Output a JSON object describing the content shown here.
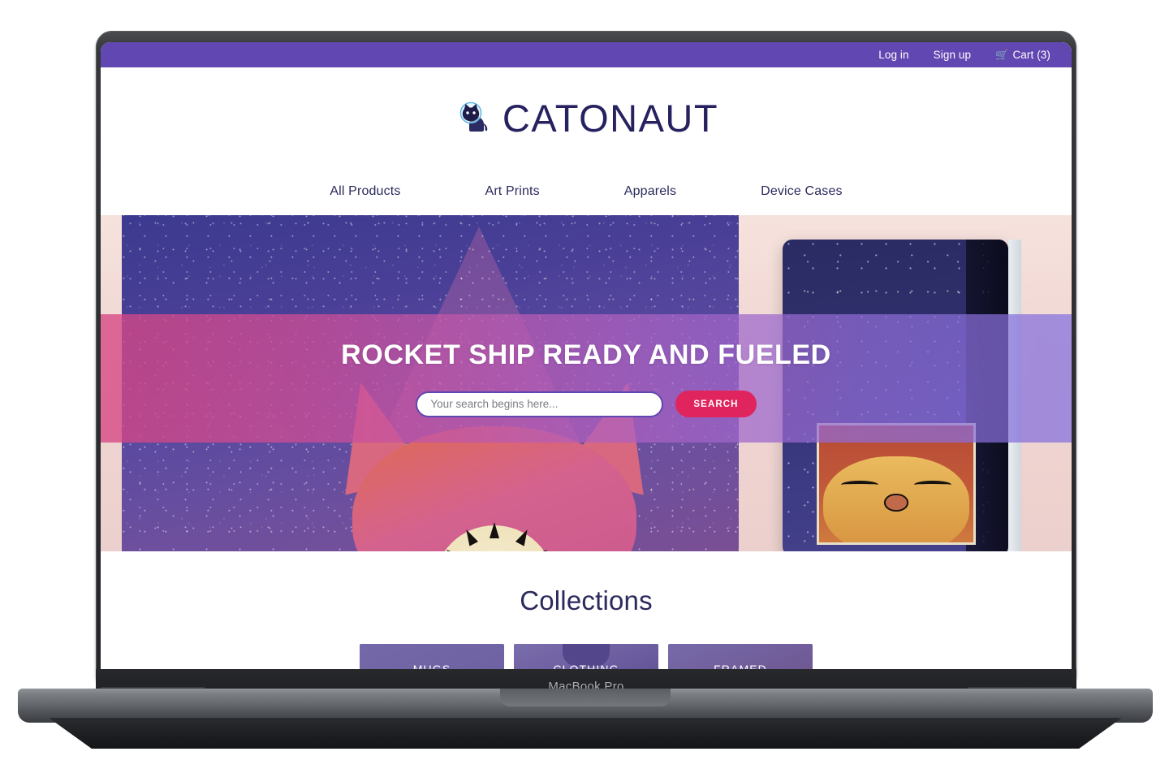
{
  "device": {
    "label": "MacBook Pro"
  },
  "topbar": {
    "login": "Log in",
    "signup": "Sign up",
    "cart": "Cart (3)",
    "cart_icon": "shopping-cart-icon",
    "background": "#6147b1"
  },
  "brand": {
    "name": "CATONAUT",
    "logo_icon": "cat-astronaut-logo-icon",
    "color": "#262260"
  },
  "nav": {
    "items": [
      {
        "label": "All Products"
      },
      {
        "label": "Art Prints"
      },
      {
        "label": "Apparels"
      },
      {
        "label": "Device Cases"
      }
    ]
  },
  "hero": {
    "title": "ROCKET SHIP READY AND FUELED",
    "search": {
      "placeholder": "Your search begins here...",
      "value": "",
      "button_label": "SEARCH",
      "button_color": "#e0245e"
    },
    "band_gradient_from": "#d64684",
    "band_gradient_to": "#8270de"
  },
  "collections": {
    "heading": "Collections",
    "items": [
      {
        "label": "MUGS"
      },
      {
        "label": "CLOTHING"
      },
      {
        "label": "FRAMED"
      }
    ]
  }
}
